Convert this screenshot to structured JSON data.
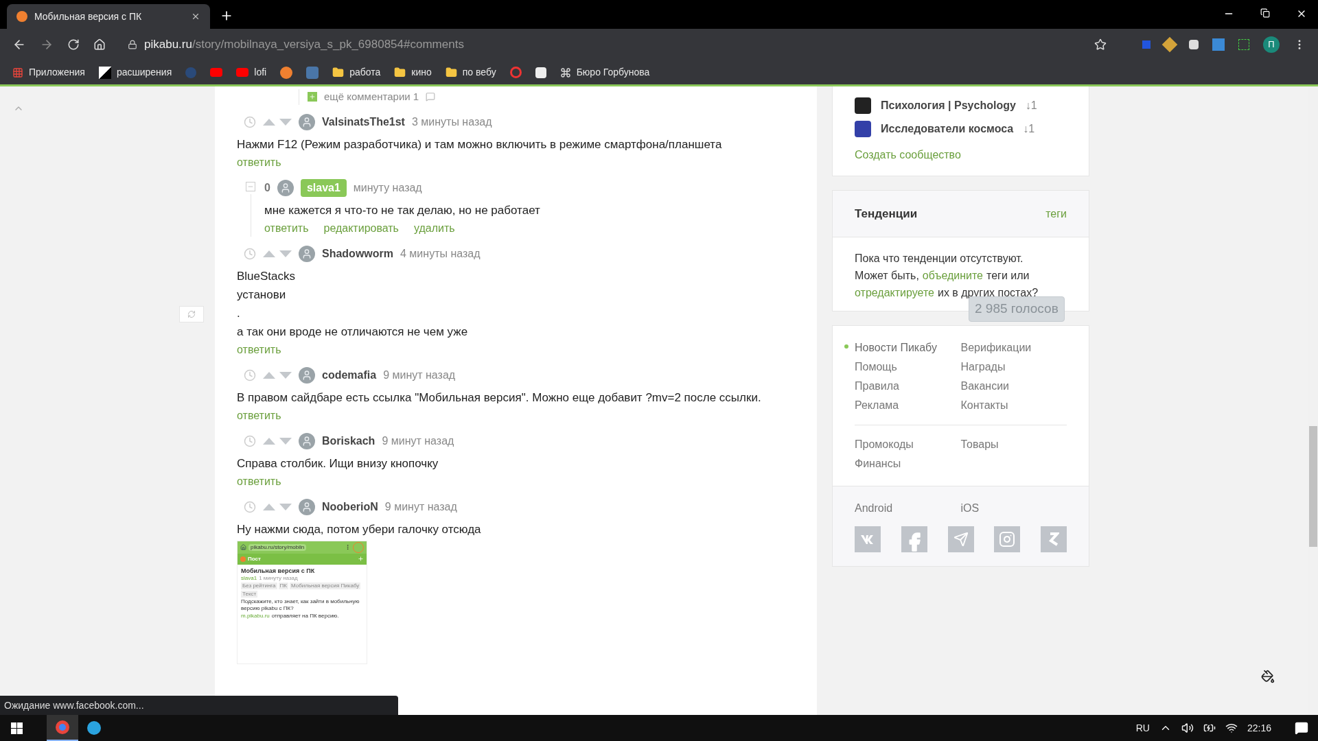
{
  "browser": {
    "tabs": [
      {
        "title": "Мобильная версия с ПК",
        "selected": true
      }
    ],
    "url_host": "pikabu.ru",
    "url_path": "/story/mobilnaya_versiya_s_pk_6980854#comments",
    "profile_initial": "П",
    "bookmarks": [
      "Приложения",
      "расширения",
      "lofi",
      "работа",
      "кино",
      "по вебу",
      "Бюро Горбунова"
    ]
  },
  "more_comments": {
    "label": "ещё комментарии 1"
  },
  "comments": [
    {
      "kind": "comment",
      "author": "ValsinatsThe1st",
      "is_post_author": false,
      "time": "3 минуты назад",
      "lines": [
        "Нажми F12 (Режим разработчика) и там можно включить в режиме смартфона/планшета"
      ],
      "actions": [
        "ответить"
      ]
    },
    {
      "kind": "reply",
      "score": "0",
      "author": "slava1",
      "is_post_author": true,
      "time": "минуту назад",
      "lines": [
        "мне кажется я что-то не так делаю, но не работает"
      ],
      "actions": [
        "ответить",
        "редактировать",
        "удалить"
      ]
    },
    {
      "kind": "comment",
      "author": "Shadowworm",
      "is_post_author": false,
      "time": "4 минуты назад",
      "lines": [
        "BlueStacks",
        "установи",
        ".",
        "а так они вроде не отличаются не чем уже"
      ],
      "actions": [
        "ответить"
      ]
    },
    {
      "kind": "comment",
      "author": "codemafia",
      "is_post_author": false,
      "time": "9 минут назад",
      "lines": [
        "В правом сайдбаре есть ссылка \"Мобильная версия\". Можно еще добавит ?mv=2 после ссылки."
      ],
      "actions": [
        "ответить"
      ]
    },
    {
      "kind": "comment",
      "author": "Boriskach",
      "is_post_author": false,
      "time": "9 минут назад",
      "lines": [
        "Справа столбик. Ищи внизу кнопочку"
      ],
      "actions": [
        "ответить"
      ]
    },
    {
      "kind": "comment",
      "author": "NooberioN",
      "is_post_author": false,
      "time": "9 минут назад",
      "lines": [
        "Ну нажми сюда, потом убери галочку отсюда"
      ],
      "screenshot": {
        "url": "pikabu.ru/story/mobiln",
        "header_title": "Пост",
        "post_title": "Мобильная версия с ПК",
        "author": "slava1",
        "time": "1 минуту назад",
        "tags": [
          "Без рейтинга",
          "ПК",
          "Мобильная версия Пикабу",
          "Текст"
        ],
        "body": "Подскажите, кто знает, как зайти в мобильную версию pikabu с ПК?",
        "link": "m.pikabu.ru",
        "link_rest": "отправляет на ПК версию."
      }
    }
  ],
  "sidebar": {
    "communities": [
      {
        "name": "Психология | Psychology",
        "count": "↓1"
      },
      {
        "name": "Исследователи космоса",
        "count": "↓1"
      }
    ],
    "create_community": "Создать сообщество",
    "trends": {
      "title": "Тенденции",
      "tags_link": "теги",
      "text_1": "Пока что тенденции отсутствуют.",
      "text_2": "Может быть,",
      "link_1": "объедините",
      "text_3": "теги или",
      "link_2": "отредактируете",
      "text_4": "их в других постах?"
    },
    "votes_badge": "2 985 голосов",
    "links": [
      {
        "label": "Новости Пикабу",
        "marked": true
      },
      {
        "label": "Верификации",
        "marked": false
      },
      {
        "label": "Помощь",
        "marked": false
      },
      {
        "label": "Награды",
        "marked": false
      },
      {
        "label": "Правила",
        "marked": false
      },
      {
        "label": "Вакансии",
        "marked": false
      },
      {
        "label": "Реклама",
        "marked": false
      },
      {
        "label": "Контакты",
        "marked": false
      }
    ],
    "extra_links": [
      "Промокоды",
      "Товары",
      "Финансы"
    ],
    "apps": [
      "Android",
      "iOS"
    ]
  },
  "status_bar": "Ожидание www.facebook.com...",
  "taskbar": {
    "apps": [
      {
        "kind": "browser",
        "selected": true
      },
      {
        "kind": "messenger",
        "selected": false
      }
    ],
    "language": "RU",
    "time": "22:16"
  }
}
